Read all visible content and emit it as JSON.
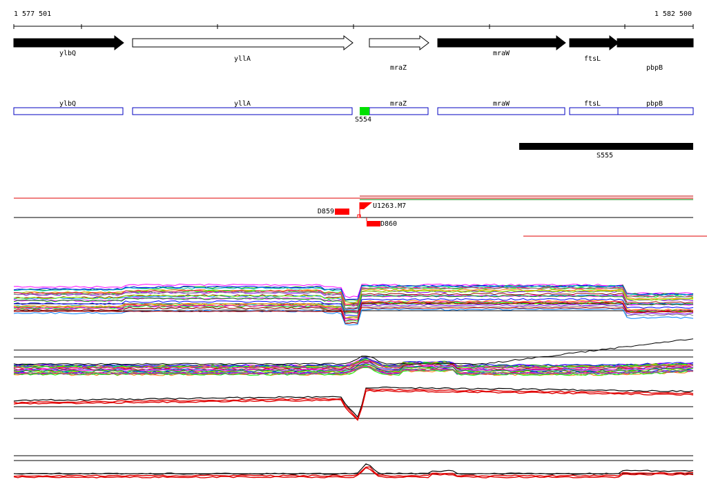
{
  "coords": {
    "start": "1 577 501",
    "end": "1 582 500"
  },
  "genes": [
    {
      "name": "ylbQ",
      "filled": true,
      "label_row": "upper"
    },
    {
      "name": "yllA",
      "filled": false,
      "label_row": "upper"
    },
    {
      "name": "mraZ",
      "filled": false,
      "label_row": "lower"
    },
    {
      "name": "mraW",
      "filled": true,
      "label_row": "upper"
    },
    {
      "name": "ftsL",
      "filled": true,
      "label_row": "upper"
    },
    {
      "name": "pbpB",
      "filled": true,
      "label_row": "lower"
    }
  ],
  "cds_boxes": [
    "ylbQ",
    "yllA",
    "mraZ",
    "mraW",
    "ftsL",
    "pbpB"
  ],
  "features": {
    "s554": {
      "label": "S554",
      "color": "#00e000"
    },
    "s555": {
      "label": "S555",
      "color": "#000000"
    }
  },
  "markers": {
    "d859": {
      "label": "D859",
      "color": "#ff0000"
    },
    "d860": {
      "label": "D860",
      "color": "#ff0000"
    },
    "u1263": {
      "label": "U1263.M7",
      "color": "#ff0000"
    }
  },
  "colors": {
    "cds_outline": "#0000c0",
    "accent_red": "#ff0000",
    "axis": "#000000",
    "trace_palette": [
      "#ff00ff",
      "#00a000",
      "#0000ff",
      "#00c0c0",
      "#c0c000",
      "#ff8000",
      "#8000ff",
      "#00ff00",
      "#ff0080",
      "#808080",
      "#a00000",
      "#0080ff",
      "#80ff00",
      "#c080ff"
    ]
  },
  "icons": [
    "arrow-forward-icon",
    "flag-icon"
  ]
}
